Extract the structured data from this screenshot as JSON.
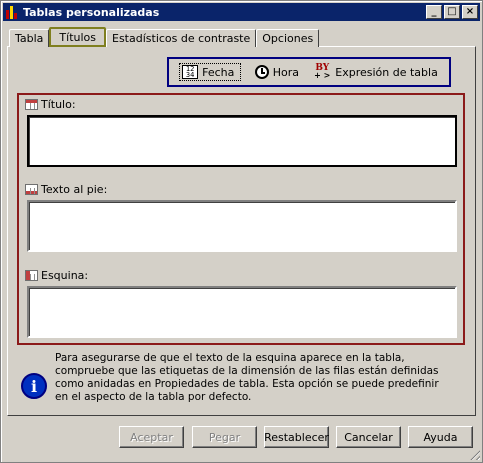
{
  "window": {
    "title": "Tablas personalizadas",
    "controls": {
      "minimize": "_",
      "maximize": "□",
      "close": "×"
    }
  },
  "tabs": [
    {
      "label": "Tabla",
      "active": false
    },
    {
      "label": "Títulos",
      "active": true
    },
    {
      "label": "Estadísticos de contraste",
      "active": false
    },
    {
      "label": "Opciones",
      "active": false
    }
  ],
  "insert": {
    "fecha": "Fecha",
    "hora": "Hora",
    "expresion": "Expresión de tabla",
    "fecha_icon_text": "12\n34",
    "by_icon_text": "BY",
    "by_icon_sub": "+ >"
  },
  "fields": {
    "titulo_label": "Título:",
    "titulo_value": "",
    "pie_label": "Texto al pie:",
    "pie_value": "",
    "esquina_label": "Esquina:",
    "esquina_value": ""
  },
  "info": {
    "icon_glyph": "i",
    "text": "Para asegurarse de que el texto de la esquina aparece en la tabla, compruebe que las etiquetas de la dimensión de las filas están definidas como anidadas en Propiedades de tabla. Esta opción se puede predefinir en el aspecto de la tabla por defecto."
  },
  "buttons": {
    "aceptar": "Aceptar",
    "pegar": "Pegar",
    "restablecer": "Restablecer",
    "cancelar": "Cancelar",
    "ayuda": "Ayuda"
  },
  "colors": {
    "titlebar": "#0a246a",
    "active_tab_border": "#7f7f1f",
    "insert_box_border": "#000080",
    "fields_border": "#8b1a1a"
  }
}
